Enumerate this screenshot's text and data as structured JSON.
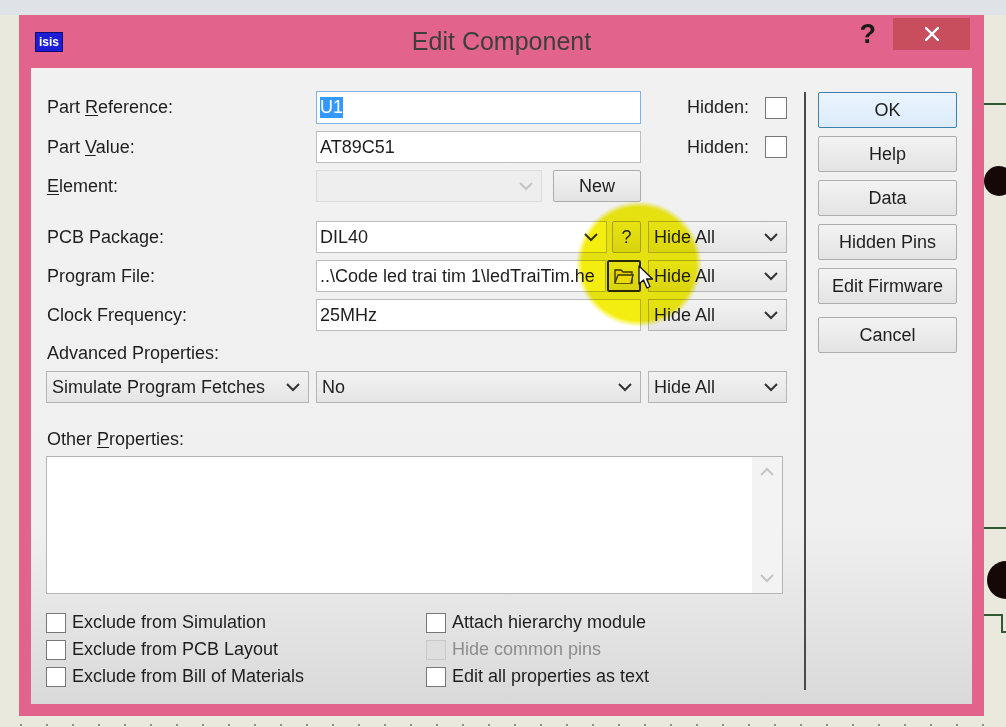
{
  "window": {
    "icon_text": "isis",
    "title": "Edit Component",
    "help_glyph": "?"
  },
  "rows": [
    {
      "label": [
        {
          "text": "Part ",
          "underline": false
        },
        {
          "text": "R",
          "underline": true
        },
        {
          "text": "eference:",
          "underline": false
        }
      ],
      "input": {
        "kind": "text",
        "value": "U1",
        "focused": true,
        "disabled": false
      },
      "hidden": {
        "label": "Hidden:",
        "checked": false
      }
    },
    {
      "label": [
        {
          "text": "Part ",
          "underline": false
        },
        {
          "text": "V",
          "underline": true
        },
        {
          "text": "alue:",
          "underline": false
        }
      ],
      "input": {
        "kind": "text",
        "value": "AT89C51",
        "focused": false,
        "disabled": false
      },
      "hidden": {
        "label": "Hidden:",
        "checked": false
      }
    },
    {
      "label": [
        {
          "text": "E",
          "underline": true
        },
        {
          "text": "lement:",
          "underline": false
        }
      ],
      "input": {
        "kind": "combo",
        "focused": false,
        "disabled": true
      },
      "button": {
        "kind": "text",
        "label": "New",
        "hovered": false
      }
    },
    {
      "label": [
        {
          "text": "PCB Package:",
          "underline": false
        }
      ],
      "input": {
        "kind": "combo",
        "value": "DIL40",
        "focused": false,
        "disabled": false
      },
      "button": {
        "kind": "text",
        "label": "?",
        "hovered": false
      },
      "visibility": "Hide All"
    },
    {
      "label": [
        {
          "text": "Program File:",
          "underline": false
        }
      ],
      "input": {
        "kind": "text",
        "value": "..\\Code led trai tim 1\\ledTraiTim.he",
        "focused": false,
        "disabled": false
      },
      "button": {
        "kind": "folder",
        "hovered": true
      },
      "visibility": "Hide All"
    },
    {
      "label": [
        {
          "text": "Clock Frequency:",
          "underline": false
        }
      ],
      "input": {
        "kind": "text",
        "value": "25MHz",
        "focused": false,
        "disabled": false
      },
      "visibility": "Hide All"
    }
  ],
  "advanced": {
    "label": "Advanced Properties:",
    "property": "Simulate Program Fetches",
    "value": "No",
    "visibility": "Hide All"
  },
  "other_properties": {
    "label": [
      {
        "text": "Other ",
        "underline": false
      },
      {
        "text": "P",
        "underline": true
      },
      {
        "text": "roperties:",
        "underline": false
      }
    ]
  },
  "option_columns": [
    {
      "items": [
        {
          "label": "Exclude from Simulation",
          "checked": false,
          "disabled": false
        },
        {
          "label": "Exclude from PCB Layout",
          "checked": false,
          "disabled": false
        },
        {
          "label": "Exclude from Bill of Materials",
          "checked": false,
          "disabled": false
        }
      ]
    },
    {
      "items": [
        {
          "label": "Attach hierarchy module",
          "checked": false,
          "disabled": false
        },
        {
          "label": "Hide common pins",
          "checked": false,
          "disabled": true
        },
        {
          "label": "Edit all properties as text",
          "checked": false,
          "disabled": false
        }
      ]
    }
  ],
  "buttons": [
    {
      "label": "OK",
      "default": true
    },
    {
      "label": "Help",
      "default": false
    },
    {
      "label": "Data",
      "default": false
    },
    {
      "label": "Hidden Pins",
      "default": false
    },
    {
      "label": "Edit Firmware",
      "default": false
    },
    {
      "label": "Cancel",
      "default": false
    }
  ]
}
